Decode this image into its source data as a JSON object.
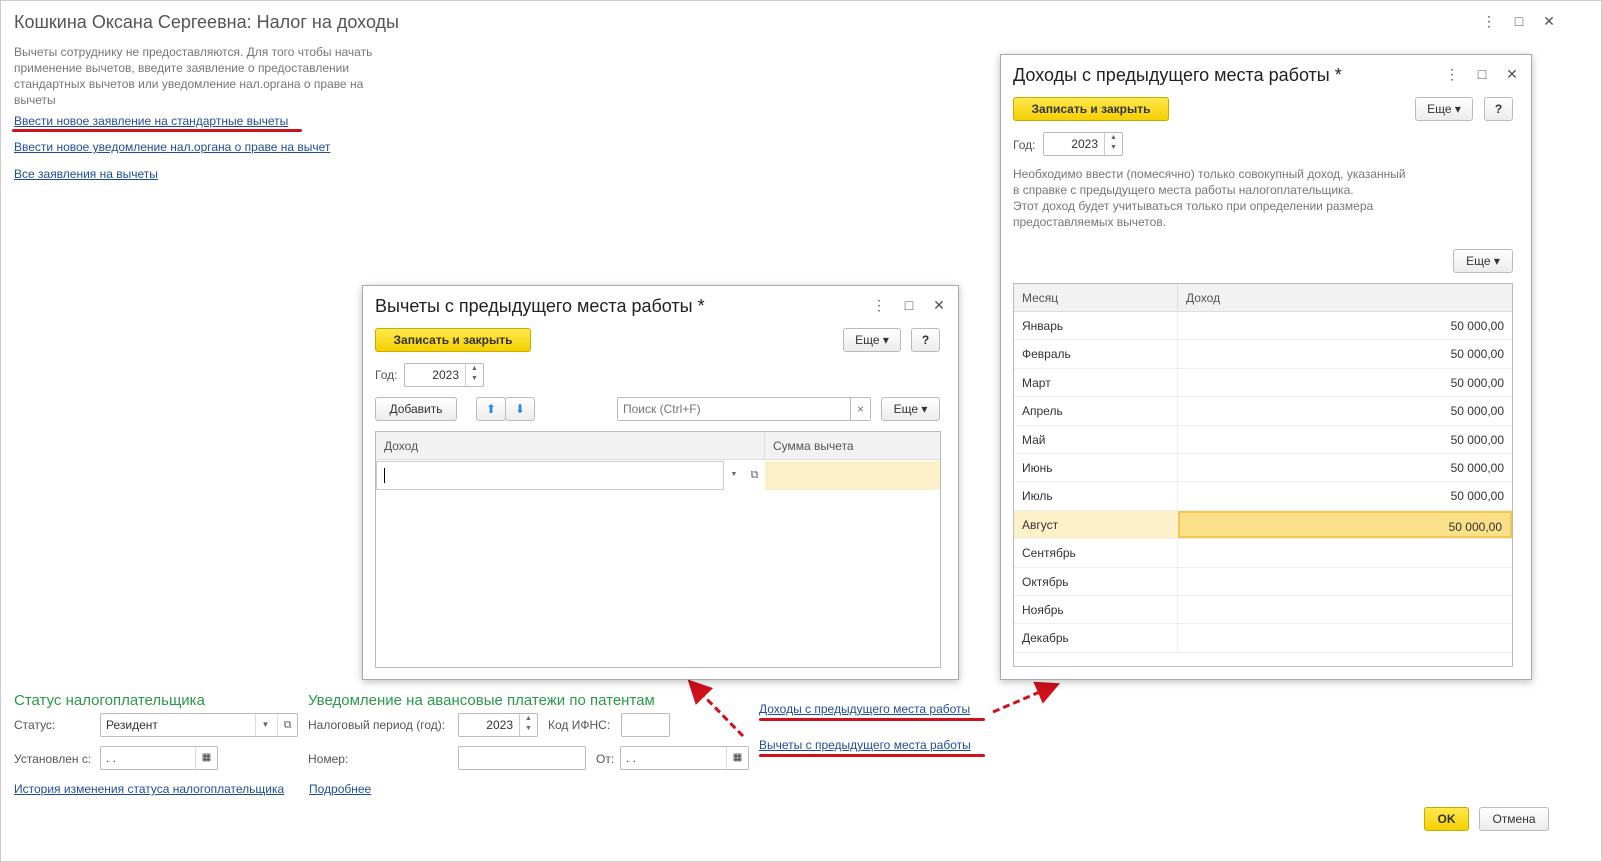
{
  "main": {
    "title": "Кошкина Оксана Сергеевна: Налог на доходы",
    "hint": "Вычеты сотруднику не предоставляются. Для того чтобы начать применение вычетов, введите заявление о предоставлении стандартных вычетов или уведомление нал.органа о праве на вычеты",
    "links": [
      "Ввести новое заявление на стандартные вычеты",
      "Ввести новое уведомление нал.органа о праве на вычет",
      "Все заявления на вычеты"
    ],
    "status_section": {
      "heading": "Статус налогоплательщика",
      "status_label": "Статус:",
      "status_value": "Резидент",
      "since_label": "Установлен с:",
      "since_value": " .  . ",
      "history_link": "История изменения статуса налогоплательщика"
    },
    "patent_section": {
      "heading": "Уведомление на авансовые платежи по патентам",
      "period_label": "Налоговый период (год):",
      "period_value": "2023",
      "ifns_label": "Код ИФНС:",
      "ifns_value": "",
      "number_label": "Номер:",
      "number_value": "",
      "from_label": "От:",
      "from_value": " .  . ",
      "more_link": "Подробнее"
    },
    "prev_links": [
      "Доходы с предыдущего места работы",
      "Вычеты с предыдущего места работы"
    ],
    "ok": "OK",
    "cancel": "Отмена"
  },
  "deductions_dialog": {
    "title": "Вычеты с предыдущего места работы *",
    "save": "Записать и закрыть",
    "more": "Еще",
    "help": "?",
    "year_label": "Год:",
    "year": "2023",
    "add": "Добавить",
    "search_placeholder": "Поиск (Ctrl+F)",
    "clear": "×",
    "columns": [
      "Доход",
      "Сумма вычета"
    ]
  },
  "income_dialog": {
    "title": "Доходы с предыдущего места работы *",
    "save": "Записать и закрыть",
    "more": "Еще",
    "help": "?",
    "year_label": "Год:",
    "year": "2023",
    "note": "Необходимо ввести (помесячно) только совокупный доход, указанный в справке с предыдущего места работы налогоплательщика.\nЭтот доход будет учитываться только при определении размера предоставляемых вычетов.",
    "columns": [
      "Месяц",
      "Доход"
    ],
    "rows": [
      {
        "month": "Январь",
        "income": "50 000,00"
      },
      {
        "month": "Февраль",
        "income": "50 000,00"
      },
      {
        "month": "Март",
        "income": "50 000,00"
      },
      {
        "month": "Апрель",
        "income": "50 000,00"
      },
      {
        "month": "Май",
        "income": "50 000,00"
      },
      {
        "month": "Июнь",
        "income": "50 000,00"
      },
      {
        "month": "Июль",
        "income": "50 000,00"
      },
      {
        "month": "Август",
        "income": "50 000,00"
      },
      {
        "month": "Сентябрь",
        "income": ""
      },
      {
        "month": "Октябрь",
        "income": ""
      },
      {
        "month": "Ноябрь",
        "income": ""
      },
      {
        "month": "Декабрь",
        "income": ""
      }
    ]
  },
  "colors": {
    "accent": "#f5d000",
    "link": "#1f4d9b",
    "heading": "#2a9a4a",
    "annotation": "#d0101a"
  }
}
